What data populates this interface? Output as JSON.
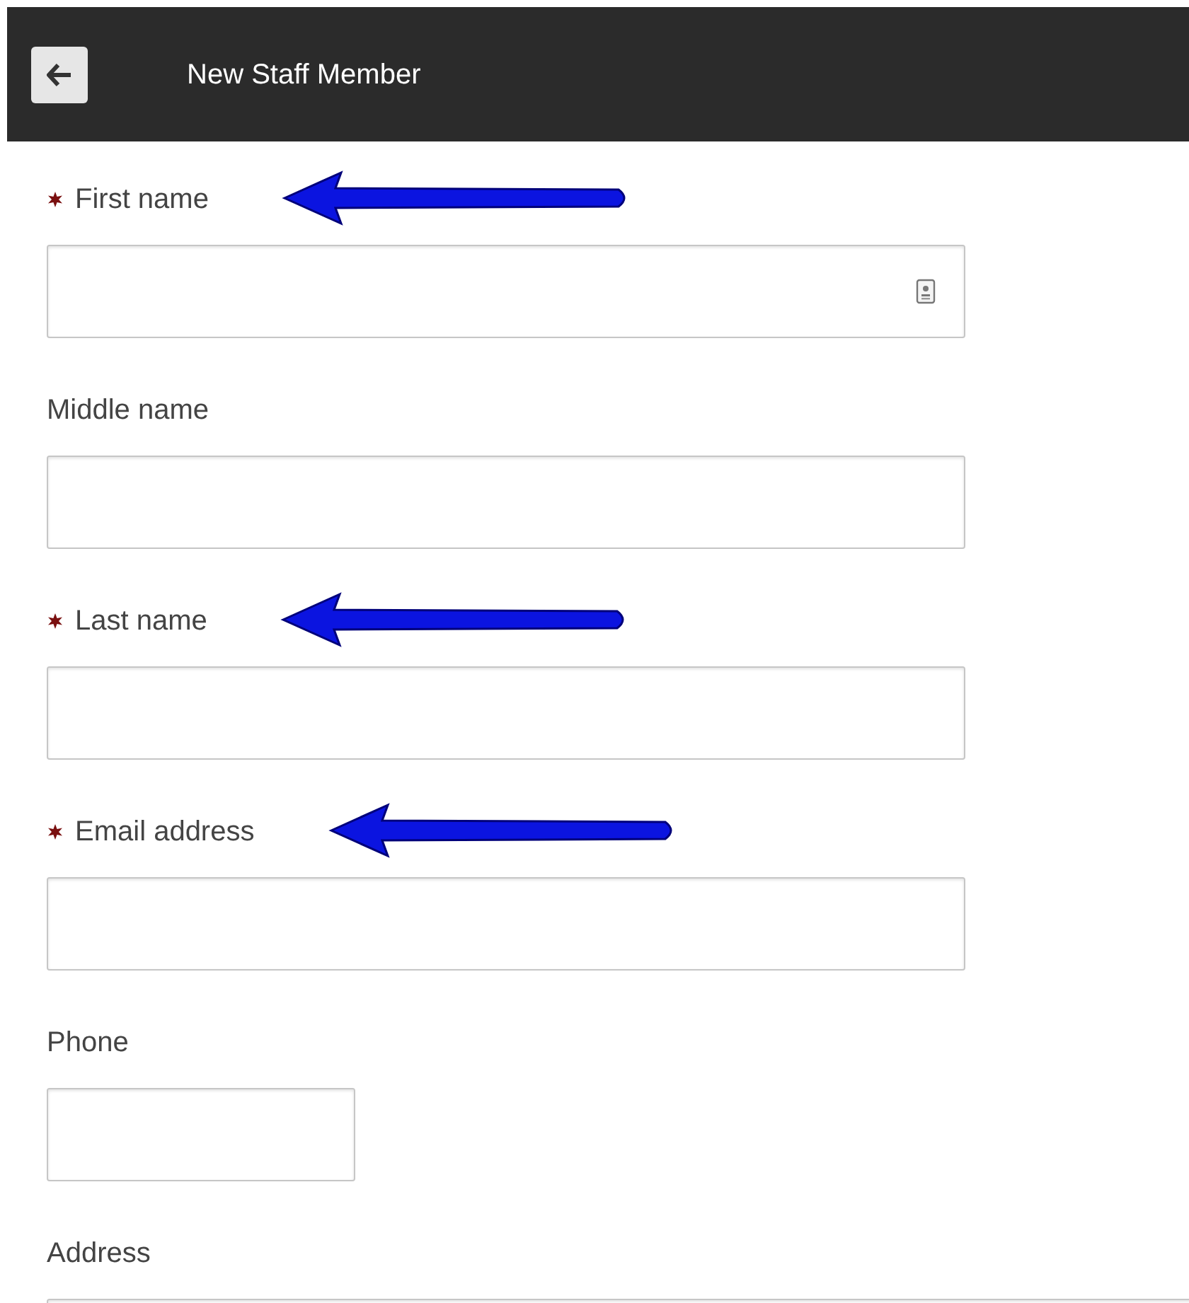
{
  "header": {
    "title": "New Staff Member"
  },
  "fields": [
    {
      "label": "First name",
      "required": true,
      "kind": "wide",
      "contact_icon": true,
      "annotated": true
    },
    {
      "label": "Middle name",
      "required": false,
      "kind": "wide",
      "contact_icon": false,
      "annotated": false
    },
    {
      "label": "Last name",
      "required": true,
      "kind": "wide",
      "contact_icon": false,
      "annotated": true
    },
    {
      "label": "Email address",
      "required": true,
      "kind": "wide",
      "contact_icon": false,
      "annotated": true
    },
    {
      "label": "Phone",
      "required": false,
      "kind": "short",
      "contact_icon": false,
      "annotated": false
    },
    {
      "label": "Address",
      "required": false,
      "kind": "full",
      "contact_icon": false,
      "annotated": false
    }
  ]
}
